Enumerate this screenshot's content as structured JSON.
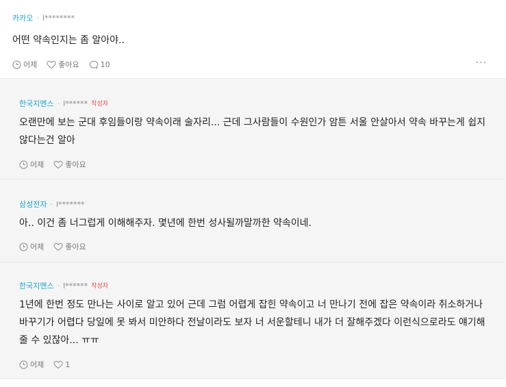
{
  "post": {
    "company": "카카오",
    "author": "l********",
    "content": "어떤 약속인지는 좀 알아야..",
    "time": "어제",
    "like_label": "좋아요",
    "comment_count": "10",
    "more_label": "···"
  },
  "replies": [
    {
      "company": "한국지멘스",
      "author": "l******",
      "writer_tag": "작성자",
      "content": "오랜만에 보는 군대 후임들이랑 약속이래 술자리... 근데 그사람들이 수원인가 암튼 서울 안살아서 약속 바꾸는게 쉽지 않다는건 알아",
      "time": "어제",
      "like_label": "좋아요"
    },
    {
      "company": "삼성전자",
      "author": "l*******",
      "content": "아.. 이건 좀 너그럽게 이해해주자. 몇년에 한번 성사될까말까한 약속이네.",
      "time": "어제",
      "like_label": "좋아요"
    },
    {
      "company": "한국지멘스",
      "author": "l******",
      "writer_tag": "작성자",
      "content": "1년에 한번 정도 만나는 사이로 알고 있어 근데 그럼 어렵게 잡힌 약속이고 너 만나기 전에 잡은 약속이라 취소하거나 바꾸기가 어렵다 당일에 못 봐서 미안하다 전날이라도 보자 너 서운할테니 내가 더 잘해주겠다 이런식으로라도 얘기해줄 수 있잖아... ㅠㅠ",
      "time": "어제",
      "like_label": "1"
    }
  ]
}
